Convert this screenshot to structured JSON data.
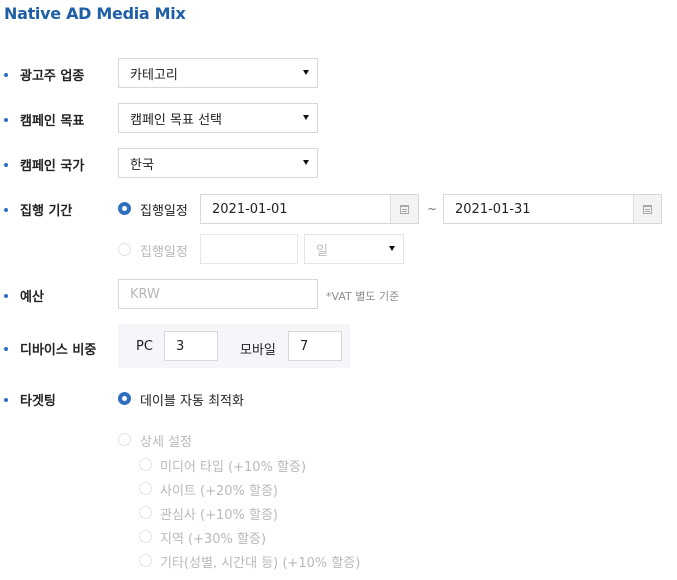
{
  "title": "Native AD Media Mix",
  "industry": {
    "label": "광고주 업종",
    "value": "카테고리"
  },
  "goal": {
    "label": "캠페인 목표",
    "value": "캠페인 목표 선택"
  },
  "country": {
    "label": "캠페인 국가",
    "value": "한국"
  },
  "period": {
    "label": "집행 기간",
    "option1_label": "집행일정",
    "start_date": "2021-01-01",
    "separator": "~",
    "end_date": "2021-01-31",
    "option2_label": "집행일정",
    "days_value": "",
    "unit_value": "일"
  },
  "budget": {
    "label": "예산",
    "placeholder": "KRW",
    "note": "*VAT 별도 기준"
  },
  "device": {
    "label": "디바이스 비중",
    "pc_label": "PC",
    "pc_value": "3",
    "mobile_label": "모바일",
    "mobile_value": "7"
  },
  "targeting": {
    "label": "타겟팅",
    "auto_label": "데이블 자동 최적화",
    "detail_label": "상세 설정",
    "options": [
      "미디어 타입 (+10% 할증)",
      "사이트 (+20% 할증)",
      "관심사 (+10% 할증)",
      "지역 (+30% 할증)",
      "기타(성별, 시간대 등) (+10% 할증)"
    ]
  },
  "colors": {
    "accent": "#2f6fbf",
    "title": "#1f5fa8",
    "disabled": "#b9b9b9"
  }
}
